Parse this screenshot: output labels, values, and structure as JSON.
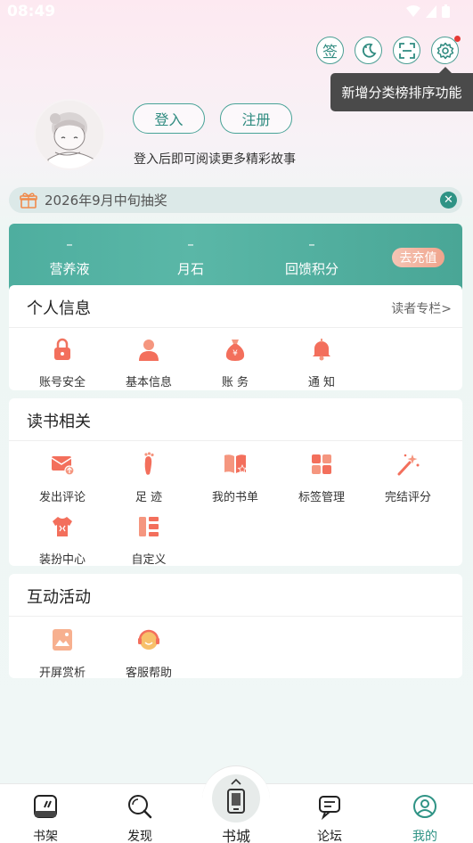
{
  "status_bar": {
    "time": "08:49"
  },
  "top_actions": {
    "sign_label": "签"
  },
  "tooltip": {
    "text": "新增分类榜排序功能"
  },
  "auth": {
    "login_label": "登入",
    "register_label": "注册",
    "hint": "登入后即可阅读更多精彩故事"
  },
  "notice": {
    "text": "2026年9月中旬抽奖"
  },
  "wallet": {
    "stats": [
      {
        "value": "–",
        "label": "营养液"
      },
      {
        "value": "–",
        "label": "月石"
      },
      {
        "value": "–",
        "label": "回馈积分"
      }
    ],
    "recharge_label": "去充值"
  },
  "personal": {
    "title": "个人信息",
    "link": "读者专栏>",
    "items": [
      "账号安全",
      "基本信息",
      "账 务",
      "通 知"
    ]
  },
  "reading": {
    "title": "读书相关",
    "items": [
      "发出评论",
      "足 迹",
      "我的书单",
      "标签管理",
      "完结评分",
      "装扮中心",
      "自定义"
    ]
  },
  "activity": {
    "title": "互动活动",
    "items": [
      "开屏赏析",
      "客服帮助"
    ]
  },
  "bottom_nav": {
    "items": [
      "书架",
      "发现",
      "书城",
      "论坛",
      "我的"
    ],
    "active": "我的"
  },
  "colors": {
    "accent": "#2f9385",
    "icon_orange": "#f0735f",
    "active_tab": "#2f9385"
  }
}
